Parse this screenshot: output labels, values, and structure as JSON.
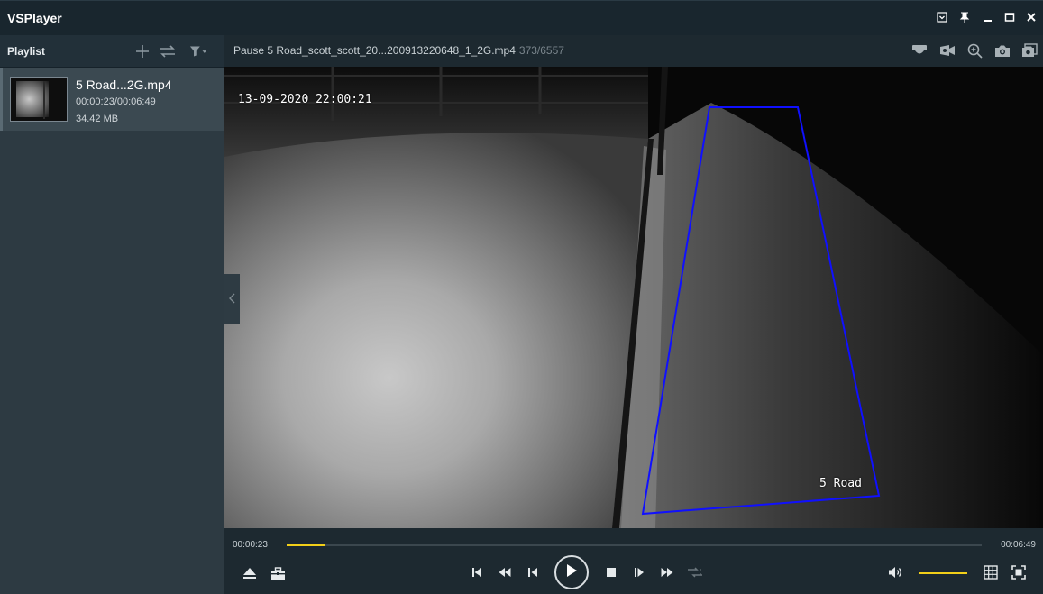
{
  "app": {
    "title": "VSPlayer",
    "window_controls": [
      "minimode-icon",
      "pin-icon",
      "minimize-icon",
      "maximize-icon",
      "close-icon"
    ]
  },
  "sidebar": {
    "title": "Playlist",
    "items": [
      {
        "name": "5 Road...2G.mp4",
        "time": "00:00:23/00:06:49",
        "size": "34.42 MB",
        "selected": true
      }
    ]
  },
  "player": {
    "status_label": "Pause 5 Road_scott_scott_20...200913220648_1_2G.mp4",
    "frame_counter": "373/6557",
    "osd_timestamp": "13-09-2020 22:00:21",
    "osd_camera": "5 Road",
    "zone_color": "#1010ff"
  },
  "controls": {
    "current_time": "00:00:23",
    "total_time": "00:06:49",
    "progress": 0.056,
    "volume": 1.0,
    "accent_color": "#f2cf19"
  }
}
